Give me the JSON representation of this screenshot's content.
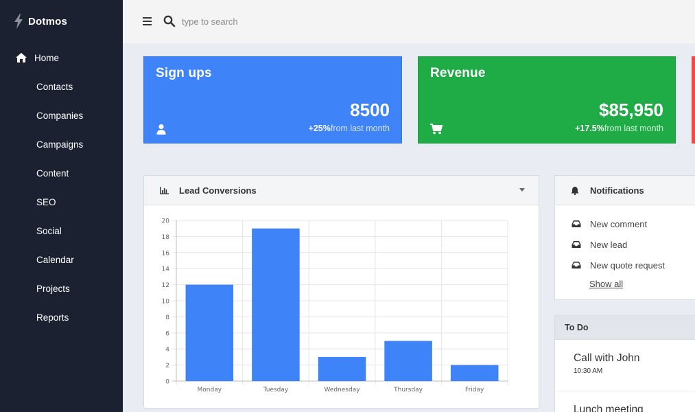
{
  "brand": {
    "name": "Dotmos",
    "icon": "bolt-icon"
  },
  "nav": [
    {
      "label": "Home",
      "icon": "home-icon",
      "active": true
    },
    {
      "label": "Contacts"
    },
    {
      "label": "Companies"
    },
    {
      "label": "Campaigns"
    },
    {
      "label": "Content"
    },
    {
      "label": "SEO"
    },
    {
      "label": "Social"
    },
    {
      "label": "Calendar"
    },
    {
      "label": "Projects"
    },
    {
      "label": "Reports"
    }
  ],
  "topbar": {
    "search_placeholder": "type to search"
  },
  "stats": {
    "signups": {
      "title": "Sign ups",
      "value": "8500",
      "change": "+25%",
      "from": "from last month",
      "icon": "user-icon",
      "color": "#3e83f8"
    },
    "revenue": {
      "title": "Revenue",
      "value": "$85,950",
      "change": "+17.5%",
      "from": "from last month",
      "icon": "cart-icon",
      "color": "#1fab46"
    }
  },
  "lead_panel": {
    "title": "Lead Conversions"
  },
  "chart_data": {
    "type": "bar",
    "categories": [
      "Monday",
      "Tuesday",
      "Wednesday",
      "Thursday",
      "Friday"
    ],
    "values": [
      12,
      19,
      3,
      5,
      2
    ],
    "ylim": [
      0,
      20
    ],
    "yticks": [
      0,
      2,
      4,
      6,
      8,
      10,
      12,
      14,
      16,
      18,
      20
    ],
    "bar_color": "#3e83f8",
    "grid": true,
    "title": "",
    "xlabel": "",
    "ylabel": ""
  },
  "notifications": {
    "title": "Notifications",
    "items": [
      "New comment",
      "New lead",
      "New quote request"
    ],
    "show_all": "Show all"
  },
  "todo": {
    "title": "To Do",
    "items": [
      {
        "title": "Call with John",
        "time": "10:30 AM"
      },
      {
        "title": "Lunch meeting",
        "time": ""
      }
    ]
  }
}
